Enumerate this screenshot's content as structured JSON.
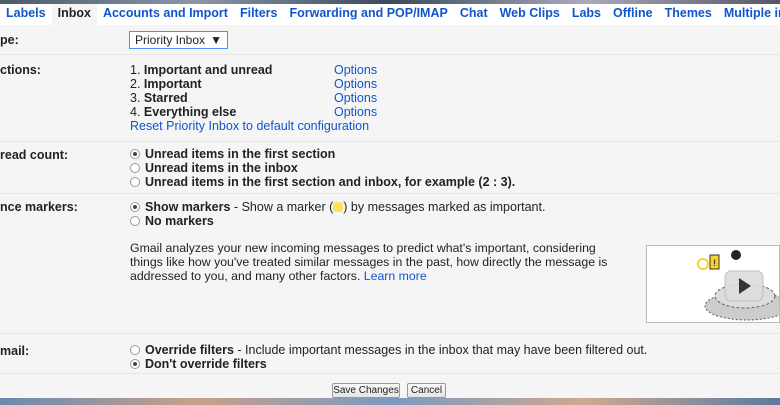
{
  "tabs": [
    "Labels",
    "Inbox",
    "Accounts and Import",
    "Filters",
    "Forwarding and POP/IMAP",
    "Chat",
    "Web Clips",
    "Labs",
    "Offline",
    "Themes",
    "Multiple inbox"
  ],
  "inbox_type": {
    "label": "pe:",
    "value": "Priority Inbox",
    "arrow": "▼"
  },
  "sections": {
    "label": "ctions:",
    "items": [
      {
        "num": "1.",
        "name": "Important and unread",
        "options": "Options"
      },
      {
        "num": "2.",
        "name": "Important",
        "options": "Options"
      },
      {
        "num": "3.",
        "name": "Starred",
        "options": "Options"
      },
      {
        "num": "4.",
        "name": "Everything else",
        "options": "Options"
      }
    ],
    "reset": "Reset Priority Inbox to default configuration"
  },
  "unread": {
    "label": "read count:",
    "options": [
      "Unread items in the first section",
      "Unread items in the inbox",
      "Unread items in the first section and inbox, for example (2 : 3)."
    ]
  },
  "markers": {
    "label": "nce markers:",
    "show": "Show markers",
    "show_desc_a": " - Show a marker (",
    "show_desc_b": ") by messages marked as important.",
    "no": "No markers",
    "desc": "Gmail analyzes your new incoming messages to predict what's important, considering things like how you've treated similar messages in the past, how directly the message is addressed to you, and many other factors.",
    "learn_more": "Learn more"
  },
  "filtered": {
    "label": "mail:",
    "override": "Override filters",
    "override_desc": " - Include important messages in the inbox that may have been filtered out.",
    "dont": "Don't override filters"
  },
  "buttons": {
    "save": "Save Changes",
    "cancel": "Cancel"
  }
}
